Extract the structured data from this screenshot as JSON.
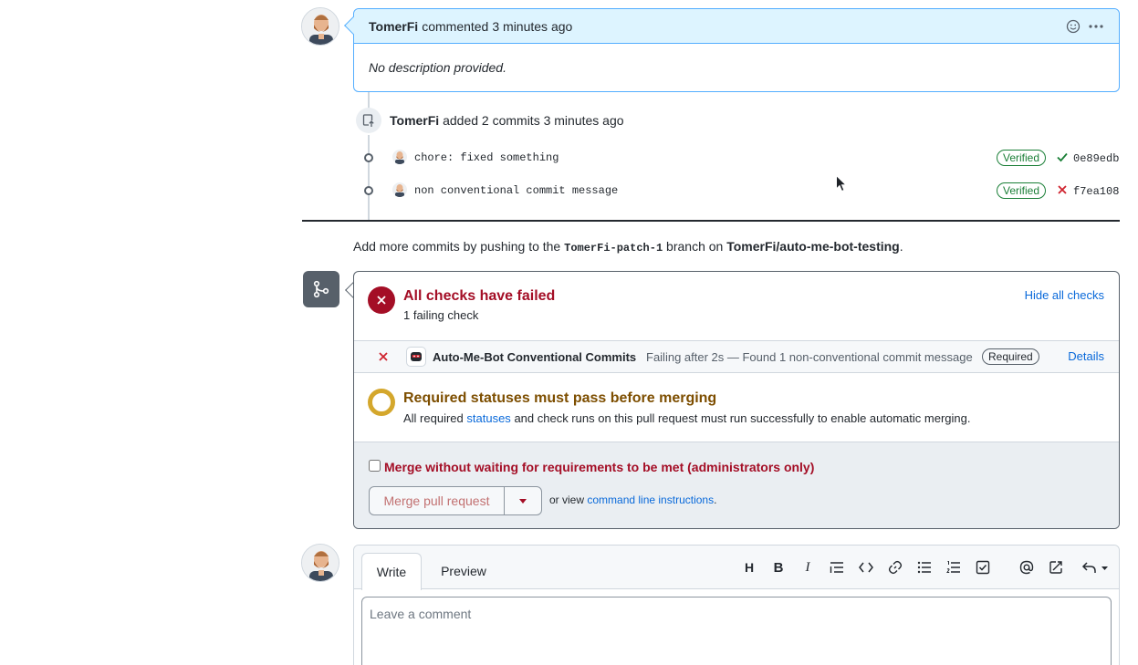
{
  "comment": {
    "author": "TomerFi",
    "action": "commented",
    "time": "3 minutes ago",
    "body": "No description provided."
  },
  "commits_event": {
    "author": "TomerFi",
    "action": "added 2 commits",
    "time": "3 minutes ago",
    "commits": [
      {
        "message": "chore: fixed something",
        "badge": "Verified",
        "status": "success",
        "sha": "0e89edb"
      },
      {
        "message": "non conventional commit message",
        "badge": "Verified",
        "status": "failure",
        "sha": "f7ea108"
      }
    ]
  },
  "push_hint": {
    "prefix": "Add more commits by pushing to the",
    "branch": "TomerFi-patch-1",
    "middle": "branch on",
    "repo": "TomerFi/auto-me-bot-testing",
    "suffix": "."
  },
  "checks": {
    "title": "All checks have failed",
    "subtitle": "1 failing check",
    "hide_label": "Hide all checks",
    "items": [
      {
        "name": "Auto-Me-Bot Conventional Commits",
        "description": "Failing after 2s — Found 1 non-conventional commit message",
        "required_label": "Required",
        "details_label": "Details"
      }
    ]
  },
  "required_statuses": {
    "title": "Required statuses must pass before merging",
    "text_prefix": "All required",
    "link": "statuses",
    "text_suffix": "and check runs on this pull request must run successfully to enable automatic merging."
  },
  "merge": {
    "bypass_label": "Merge without waiting for requirements to be met (administrators only)",
    "button_label": "Merge pull request",
    "or_view": "or view",
    "cli_link": "command line instructions",
    "cli_suffix": "."
  },
  "editor": {
    "tabs": [
      "Write",
      "Preview"
    ],
    "placeholder": "Leave a comment",
    "toolbar": [
      "H",
      "B",
      "I"
    ]
  },
  "colors": {
    "accent": "#0969da",
    "danger": "#cf222e",
    "danger_dark": "#a40e26",
    "success": "#1a7f37",
    "warning": "#d4a72c",
    "comment_header": "#ddf4ff"
  }
}
